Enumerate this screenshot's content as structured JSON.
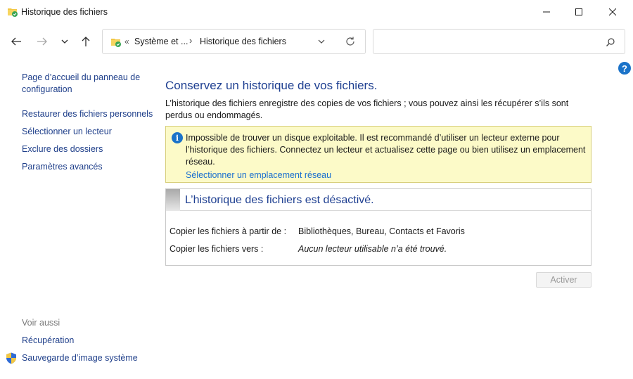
{
  "window": {
    "title": "Historique des fichiers"
  },
  "address": {
    "overflow_chevrons": "«",
    "crumbs": [
      "Système et ...",
      "Historique des fichiers"
    ],
    "separator": "›"
  },
  "search": {
    "placeholder": ""
  },
  "help": {
    "label": "?"
  },
  "sidebar": {
    "links": [
      "Page d’accueil du panneau de configuration",
      "Restaurer des fichiers personnels",
      "Sélectionner un lecteur",
      "Exclure des dossiers",
      "Paramètres avancés"
    ],
    "see_also_title": "Voir aussi",
    "see_also": [
      "Récupération",
      "Sauvegarde d’image système"
    ]
  },
  "main": {
    "title": "Conservez un historique de vos fichiers.",
    "description": "L’historique des fichiers enregistre des copies de vos fichiers ; vous pouvez ainsi les récupérer s’ils sont perdus ou endommagés.",
    "info": {
      "icon": "i",
      "text": "Impossible de trouver un disque exploitable. Il est recommandé d’utiliser un lecteur externe pour l’historique des fichiers. Connectez un lecteur et actualisez cette page ou bien utilisez un emplacement réseau.",
      "link": "Sélectionner un emplacement réseau"
    },
    "status": {
      "title": "L’historique des fichiers est désactivé.",
      "rows": [
        {
          "label": "Copier les fichiers à partir de :",
          "value": "Bibliothèques, Bureau, Contacts et Favoris"
        },
        {
          "label": "Copier les fichiers vers :",
          "value": "Aucun lecteur utilisable n’a été trouvé."
        }
      ]
    },
    "activate_button": "Activer"
  },
  "colors": {
    "link": "#1f3f8a",
    "heading": "#1e3f91",
    "info_bg": "#fcfac8",
    "info_icon": "#1b73c9"
  }
}
